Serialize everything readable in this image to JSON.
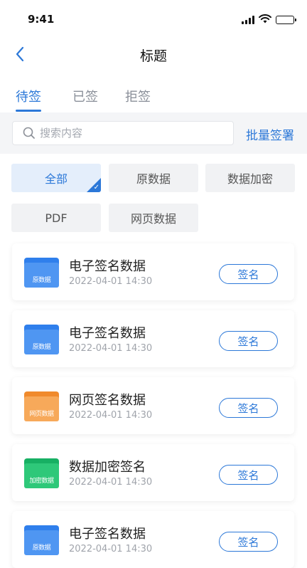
{
  "status_bar": {
    "time": "9:41"
  },
  "nav": {
    "title": "标题"
  },
  "tabs": [
    {
      "label": "待签",
      "active": true
    },
    {
      "label": "已签",
      "active": false
    },
    {
      "label": "拒签",
      "active": false
    }
  ],
  "search": {
    "placeholder": "搜索内容",
    "value": "",
    "batch_sign_label": "批量签署"
  },
  "filters": [
    {
      "label": "全部",
      "selected": true
    },
    {
      "label": "原数据",
      "selected": false
    },
    {
      "label": "数据加密",
      "selected": false
    },
    {
      "label": "PDF",
      "selected": false
    },
    {
      "label": "网页数据",
      "selected": false
    }
  ],
  "items": [
    {
      "title": "电子签名数据",
      "time": "2022-04-01  14:30",
      "icon_label": "原数据",
      "icon_type": "blue-folder-icon",
      "color_tab": "#2f7fec",
      "color_body": "#4f96f2",
      "sign_label": "签名"
    },
    {
      "title": "电子签名数据",
      "time": "2022-04-01  14:30",
      "icon_label": "原数据",
      "icon_type": "blue-folder-icon",
      "color_tab": "#2f7fec",
      "color_body": "#4f96f2",
      "sign_label": "签名"
    },
    {
      "title": "网页签名数据",
      "time": "2022-04-01  14:30",
      "icon_label": "网页数据",
      "icon_type": "orange-folder-icon",
      "color_tab": "#f08a2c",
      "color_body": "#f7a95a",
      "sign_label": "签名"
    },
    {
      "title": "数据加密签名",
      "time": "2022-04-01  14:30",
      "icon_label": "加密数据",
      "icon_type": "green-folder-icon",
      "color_tab": "#17b063",
      "color_body": "#2ec879",
      "sign_label": "签名"
    },
    {
      "title": "电子签名数据",
      "time": "2022-04-01  14:30",
      "icon_label": "原数据",
      "icon_type": "blue-folder-icon",
      "color_tab": "#2f7fec",
      "color_body": "#4f96f2",
      "sign_label": "签名"
    }
  ],
  "colors": {
    "accent": "#2c78d8",
    "chip_active_bg": "#e4eefb",
    "chip_bg": "#f1f2f4",
    "search_area_bg": "#f4f5f7"
  }
}
